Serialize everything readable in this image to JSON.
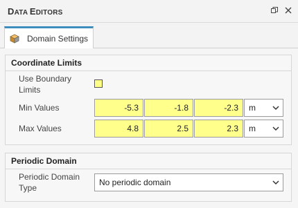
{
  "panel": {
    "title_first": "D",
    "title_rest1": "ATA ",
    "title_second": "E",
    "title_rest2": "DITORS",
    "restore_icon": "restore-icon",
    "close_icon": "close-icon"
  },
  "tabs": [
    {
      "label": "Domain Settings",
      "icon": "cube-icon",
      "active": true
    }
  ],
  "coordinate_limits": {
    "title": "Coordinate Limits",
    "use_boundary_limits_line1": "Use Boundary",
    "use_boundary_limits_line2": "Limits",
    "use_boundary_limits_checked": false,
    "min_label": "Min Values",
    "min_values": [
      "-5.3",
      "-1.8",
      "-2.3"
    ],
    "min_unit": "m",
    "max_label": "Max Values",
    "max_values": [
      "4.8",
      "2.5",
      "2.3"
    ],
    "max_unit": "m"
  },
  "periodic_domain": {
    "title": "Periodic Domain",
    "type_label_line1": "Periodic Domain",
    "type_label_line2": "Type",
    "type_value": "No periodic domain"
  },
  "colors": {
    "input_highlight": "#ffff8c",
    "tab_accent": "#3c8dbc"
  }
}
